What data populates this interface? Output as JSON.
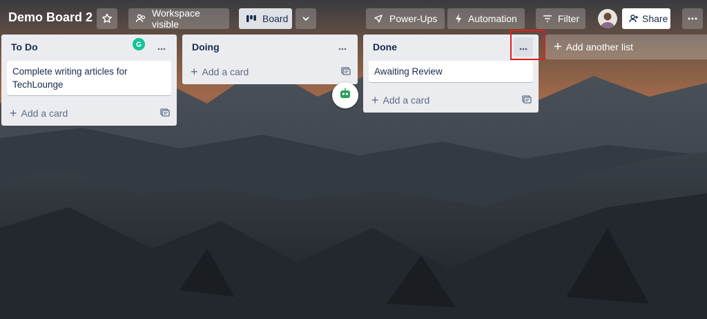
{
  "board": {
    "title": "Demo Board 2",
    "visibility_label": "Workspace visible",
    "view_label": "Board",
    "powerups_label": "Power-Ups",
    "automation_label": "Automation",
    "filter_label": "Filter",
    "share_label": "Share",
    "add_list_label": "Add another list"
  },
  "lists": [
    {
      "title": "To Do",
      "cards": [
        "Complete writing articles for TechLounge"
      ],
      "add_label": "Add a card"
    },
    {
      "title": "Doing",
      "cards": [],
      "add_label": "Add a card"
    },
    {
      "title": "Done",
      "cards": [
        "Awaiting Review"
      ],
      "add_label": "Add a card"
    }
  ],
  "colors": {
    "list_bg": "#ebecf0",
    "text_primary": "#172b4d",
    "text_muted": "#5e6c84",
    "highlight": "#e0201c",
    "grammarly": "#15c39a"
  },
  "icons": [
    "star-icon",
    "people-icon",
    "board-icon",
    "chevron-down-icon",
    "rocket-icon",
    "lightning-icon",
    "filter-icon",
    "add-member-icon",
    "more-icon",
    "card-template-icon",
    "plus-icon",
    "grammarly-icon",
    "bot-icon"
  ]
}
